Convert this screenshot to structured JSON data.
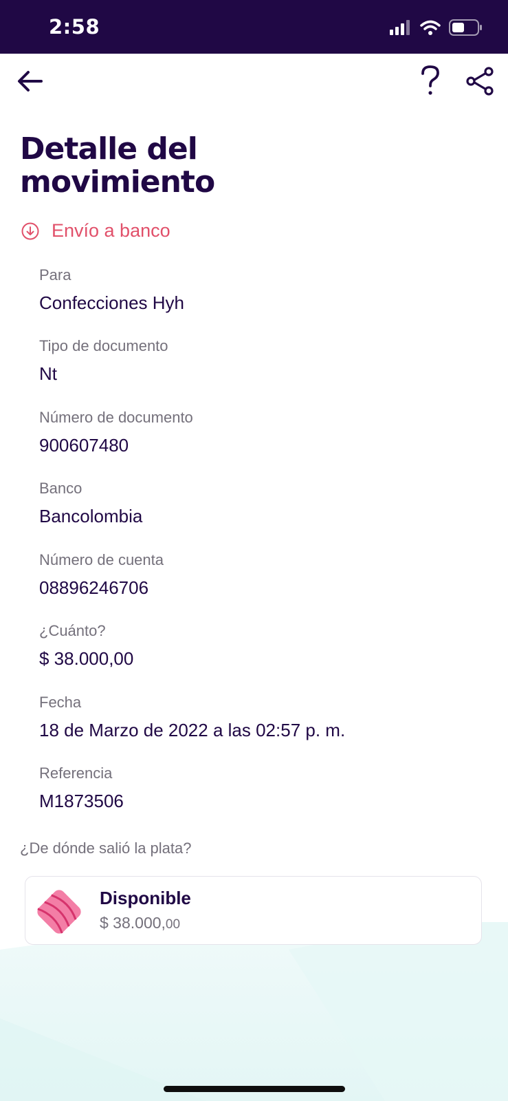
{
  "status_bar": {
    "time": "2:58"
  },
  "header": {
    "back_icon": "arrow-left-icon",
    "help_icon": "question-mark-icon",
    "share_icon": "share-icon",
    "title_line1": "Detalle del",
    "title_line2": "movimiento"
  },
  "movement": {
    "type_icon": "arrow-down-circle-icon",
    "type_label": "Envío a banco",
    "type_color": "#e1506a"
  },
  "details": [
    {
      "label": "Para",
      "value": "Confecciones Hyh"
    },
    {
      "label": "Tipo de documento",
      "value": "Nt"
    },
    {
      "label": "Número de documento",
      "value": "900607480"
    },
    {
      "label": "Banco",
      "value": "Bancolombia"
    },
    {
      "label": "Número de cuenta",
      "value": "08896246706"
    },
    {
      "label": "¿Cuánto?",
      "value": "$ 38.000,00"
    },
    {
      "label": "Fecha",
      "value": "18 de Marzo de 2022 a las 02:57 p. m."
    },
    {
      "label": "Referencia",
      "value": "M1873506"
    }
  ],
  "source": {
    "heading": "¿De dónde salió la plata?",
    "pocket_name": "Disponible",
    "pocket_amount_main": "$ 38.000,",
    "pocket_amount_cents": "00",
    "pocket_icon": "pink-pocket-icon"
  },
  "colors": {
    "brand_dark": "#200845",
    "accent_red": "#e1506a",
    "muted_text": "#74707b"
  }
}
